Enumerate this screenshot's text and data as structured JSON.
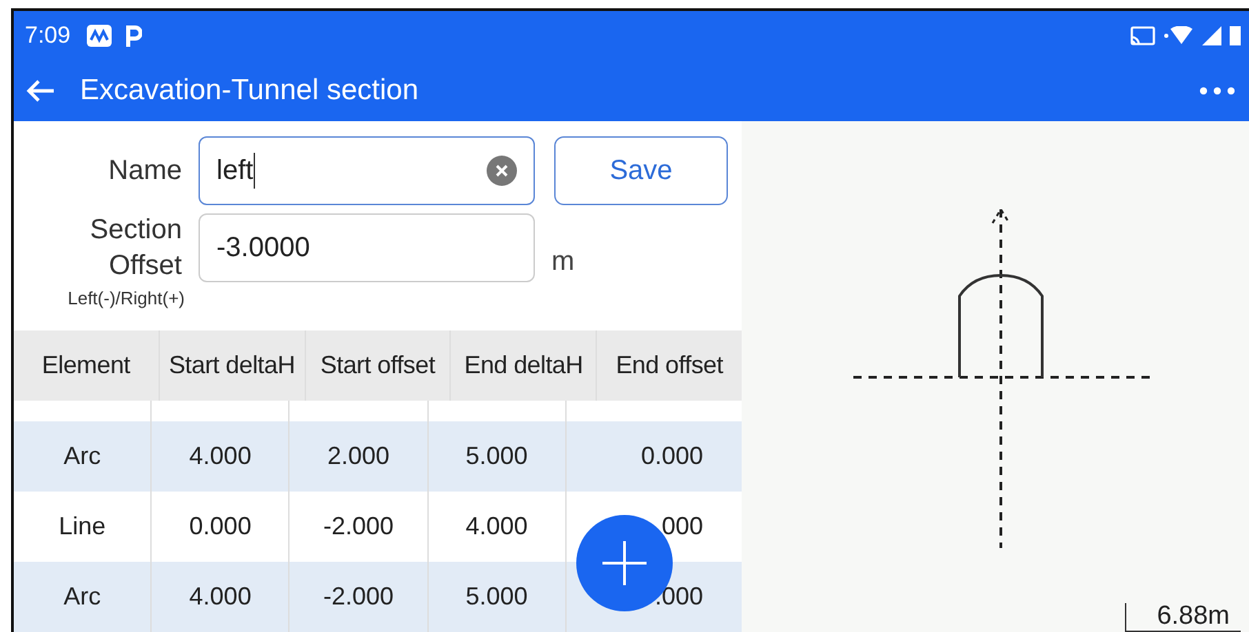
{
  "status_bar": {
    "time": "7:09"
  },
  "app_bar": {
    "title": "Excavation-Tunnel section"
  },
  "form": {
    "name_label": "Name",
    "name_value": "left",
    "save": "Save",
    "offset_label": "Section Offset",
    "offset_hint": "Left(-)/Right(+)",
    "offset_value": "-3.0000",
    "unit": "m"
  },
  "table": {
    "columns": [
      "Element",
      "Start deltaH",
      "Start offset",
      "End deltaH",
      "End offset"
    ],
    "rows": [
      {
        "cells": [
          "Arc",
          "4.000",
          "2.000",
          "5.000",
          "0.000"
        ]
      },
      {
        "cells": [
          "Line",
          "0.000",
          "-2.000",
          "4.000",
          "000"
        ]
      },
      {
        "cells": [
          "Arc",
          "4.000",
          "-2.000",
          "5.000",
          ".000"
        ]
      }
    ]
  },
  "preview": {
    "scale": "6.88m"
  }
}
